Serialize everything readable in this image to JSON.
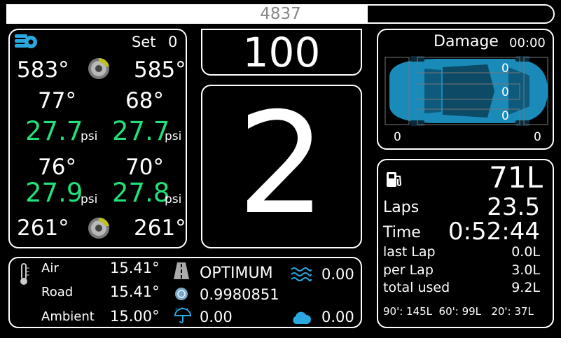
{
  "rpm_bar": {
    "value": "4837",
    "fill_fraction": 0.66,
    "fill_color": "#ffffff",
    "text_color": "#888888"
  },
  "tyres": {
    "set_label": "Set",
    "set_value": "0",
    "brake_front_left": "583°",
    "brake_front_right": "585°",
    "brake_rear_left": "261°",
    "brake_rear_right": "261°",
    "temp_front_left": "77°",
    "temp_front_right": "68°",
    "temp_rear_left": "76°",
    "temp_rear_right": "70°",
    "pressure_front_left": "27.7",
    "pressure_front_right": "27.7",
    "pressure_rear_left": "27.9",
    "pressure_rear_right": "27.8",
    "pressure_unit": "psi",
    "pressure_color": "#22e07a"
  },
  "speed": {
    "value": "100"
  },
  "gear": {
    "value": "2"
  },
  "damage": {
    "title": "Damage",
    "time": "00:00",
    "front": "0",
    "center": "0",
    "rear": "0",
    "left": "0",
    "right": "0",
    "car_color": "#1a8ab8"
  },
  "fuel": {
    "amount": "71L",
    "laps_label": "Laps",
    "laps_value": "23.5",
    "time_label": "Time",
    "time_value": "0:52:44",
    "last_lap_label": "last Lap",
    "last_lap_value": "0.0L",
    "per_lap_label": "per Lap",
    "per_lap_value": "3.0L",
    "total_used_label": "total used",
    "total_used_value": "9.2L",
    "forecast": "90': 145L  60': 99L   20': 37L"
  },
  "weather": {
    "air_label": "Air",
    "air_value": "15.41°",
    "road_label": "Road",
    "road_value": "15.41°",
    "ambient_label": "Ambient",
    "ambient_value": "15.00°",
    "track_state": "OPTIMUM",
    "grip": "0.9980851",
    "rain": "0.00",
    "water": "0.00",
    "clouds": "0.00",
    "icon_color": "#2aa8e0"
  }
}
